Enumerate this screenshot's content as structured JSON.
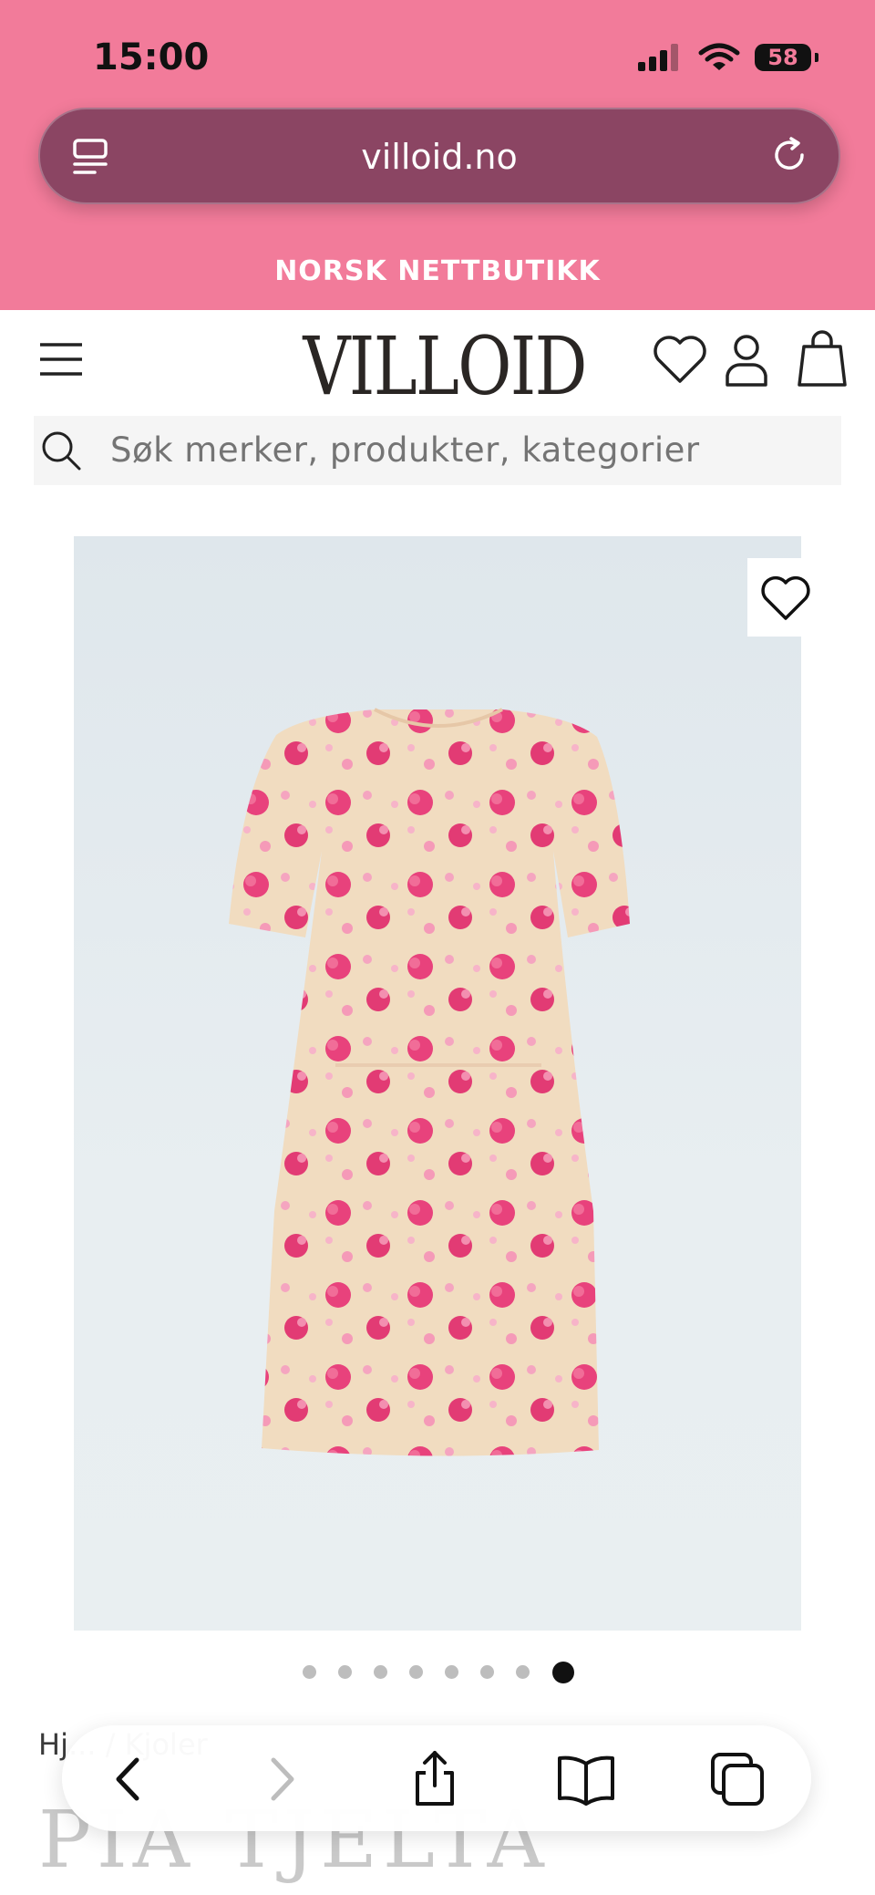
{
  "status_bar": {
    "time": "15:00",
    "battery": "58",
    "icons": [
      "signal-icon",
      "wifi-icon",
      "battery-icon"
    ]
  },
  "browser": {
    "url": "villoid.no",
    "left_icon": "tab-list-icon",
    "right_icon": "reload-icon"
  },
  "site": {
    "banner": "NORSK NETTBUTIKK",
    "logo": "VILLOID",
    "menu_icon": "hamburger-menu-icon",
    "header_icons": [
      "heart-icon",
      "user-icon",
      "shopping-bag-icon"
    ],
    "search": {
      "placeholder": "Søk merker, produkter, kategorier",
      "icon": "search-icon"
    }
  },
  "product": {
    "image_alt": "floral-dress-image",
    "wishlist_icon": "heart-icon",
    "carousel": {
      "total": 8,
      "active_index": 7
    },
    "breadcrumb": "Hj... / Kjoler",
    "brand": "PIA TJELTA"
  },
  "toolbar": {
    "buttons": [
      "back-icon",
      "forward-icon",
      "share-icon",
      "bookmarks-icon",
      "tabs-icon"
    ]
  }
}
